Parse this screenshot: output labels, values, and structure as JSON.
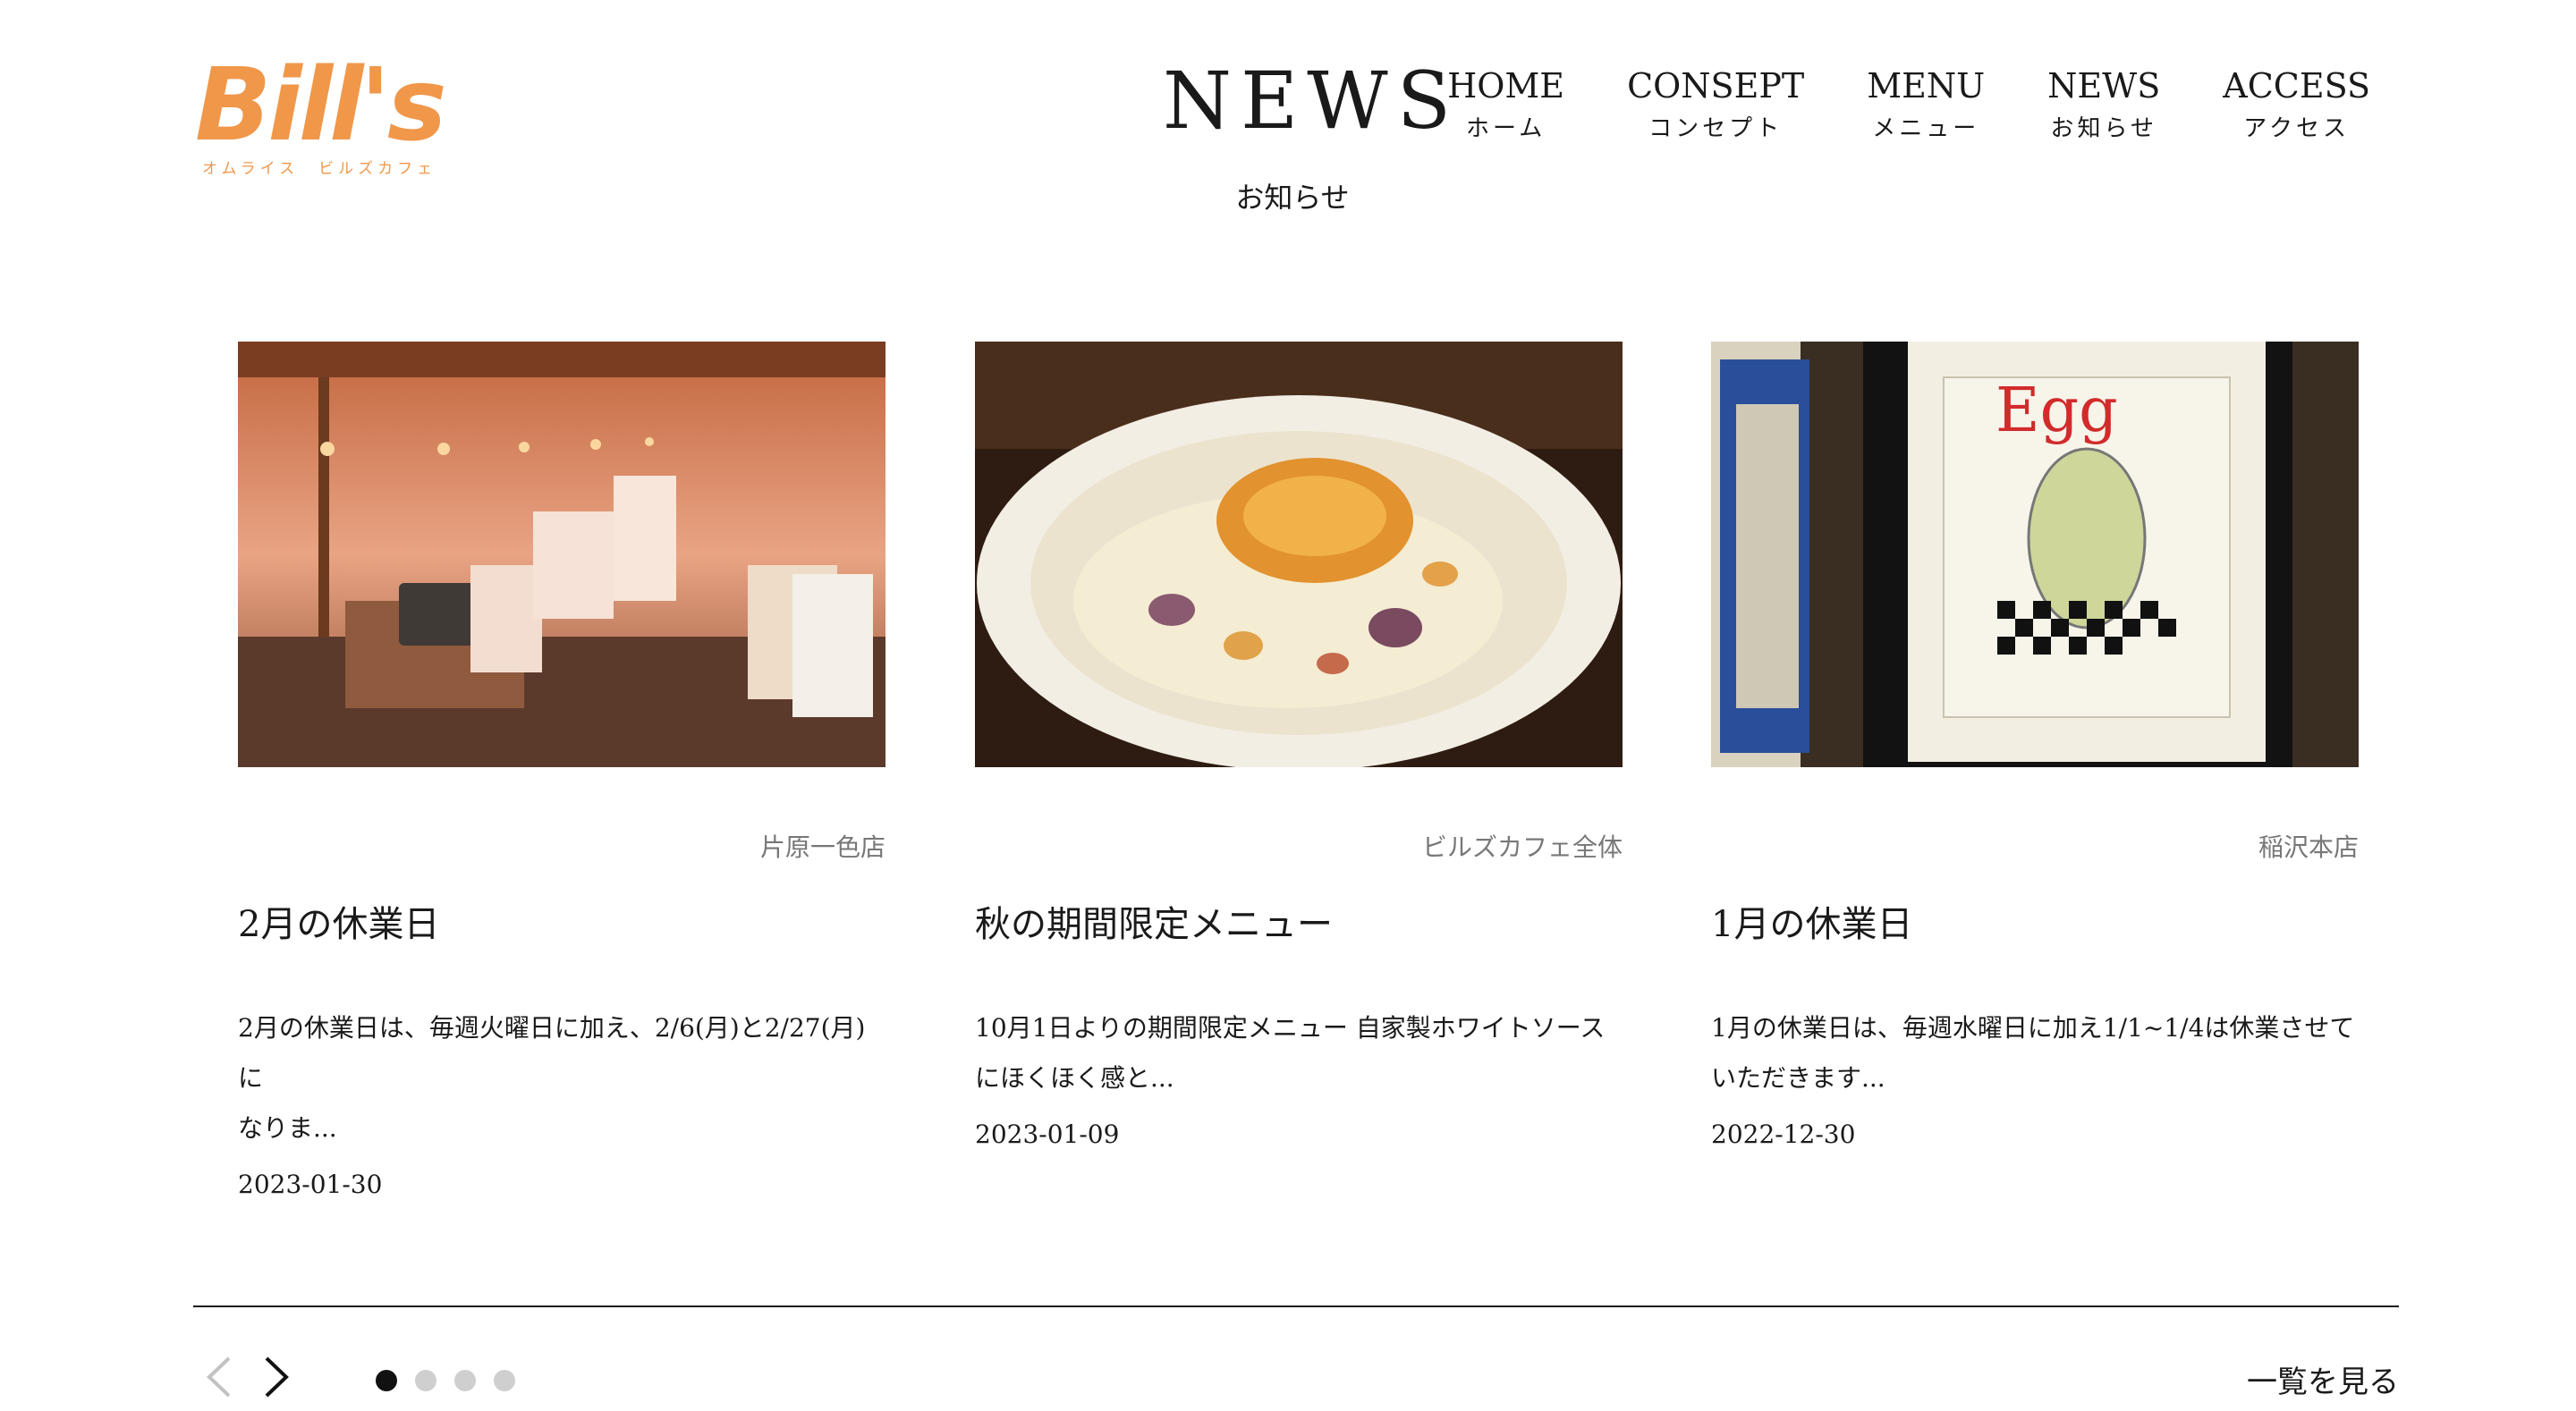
{
  "brand": {
    "logo_text": "Bill's",
    "logo_sub": "オムライス　ビルズカフェ",
    "accent": "#f0974a"
  },
  "section": {
    "title": "NEWS",
    "subtitle": "お知らせ"
  },
  "nav": [
    {
      "en": "HOME",
      "ja": "ホーム"
    },
    {
      "en": "CONSEPT",
      "ja": "コンセプト"
    },
    {
      "en": "MENU",
      "ja": "メニュー"
    },
    {
      "en": "NEWS",
      "ja": "お知らせ"
    },
    {
      "en": "ACCESS",
      "ja": "アクセス"
    }
  ],
  "cards": [
    {
      "store": "片原一色店",
      "title": "2月の休業日",
      "excerpt_1": "2月の休業日は、毎週火曜日に加え、2/6(月)と2/27(月)に",
      "excerpt_2": "なりま...",
      "date": "2023-01-30",
      "image": "restaurant-interior"
    },
    {
      "store": "ビルズカフェ全体",
      "title": "秋の期間限定メニュー",
      "excerpt_1": "10月1日よりの期間限定メニュー 自家製ホワイトソース",
      "excerpt_2": "にほくほく感と...",
      "date": "2023-01-09",
      "image": "omurice-cream-sauce"
    },
    {
      "store": "稲沢本店",
      "title": "1月の休業日",
      "excerpt_1": "1月の休業日は、毎週水曜日に加え1/1~1/4は休業させて",
      "excerpt_2": "いただきます...",
      "date": "2022-12-30",
      "image": "framed-egg-art",
      "image_text": "Egg"
    }
  ],
  "carousel": {
    "page_count": 4,
    "active_index": 0
  },
  "footer": {
    "view_all": "一覧を見る"
  }
}
